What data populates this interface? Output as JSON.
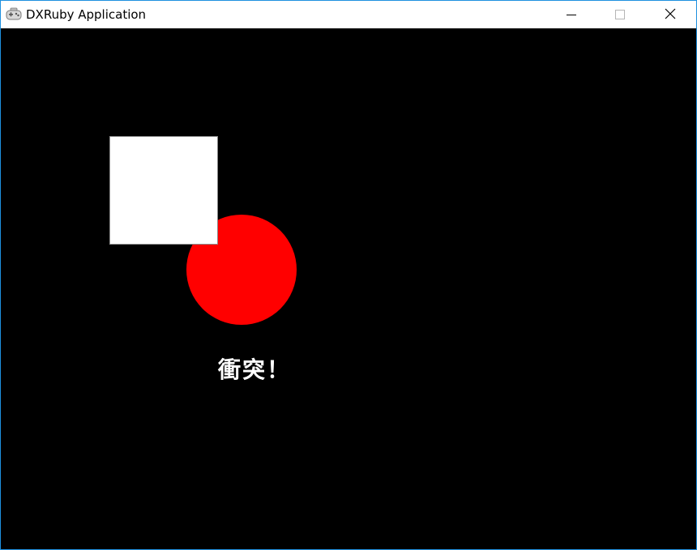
{
  "window": {
    "title": "DXRuby Application",
    "app_icon": "gamepad-icon",
    "border_color": "#1e90e0"
  },
  "controls": {
    "minimize_icon": "minimize-icon",
    "maximize_icon": "maximize-icon",
    "close_icon": "close-icon"
  },
  "scene": {
    "background": "#000000",
    "square_color": "#ffffff",
    "circle_color": "#ff0000",
    "message": "衝突！"
  }
}
